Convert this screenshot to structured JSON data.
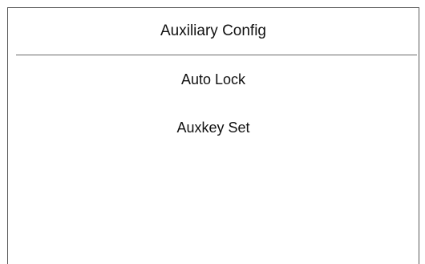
{
  "screen": {
    "title": "Auxiliary Config",
    "menu": [
      {
        "label": "Auto Lock"
      },
      {
        "label": "Auxkey Set"
      }
    ]
  },
  "colors": {
    "background": "#ffffff",
    "border": "#5a5a5a",
    "text": "#111111"
  }
}
